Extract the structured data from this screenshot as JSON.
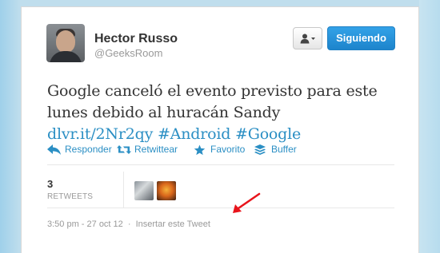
{
  "user": {
    "name": "Hector Russo",
    "handle": "@GeeksRoom"
  },
  "buttons": {
    "follow_label": "Siguiendo"
  },
  "tweet": {
    "text_line1": "Google canceló el evento previsto para este",
    "text_line2": "lunes debido al huracán Sandy",
    "link": "dlvr.it/2Nr2qy",
    "hashtag1": "#Android",
    "hashtag2": "#Google"
  },
  "actions": [
    {
      "label": "Responder",
      "icon": "reply-icon"
    },
    {
      "label": "Retwittear",
      "icon": "retweet-icon"
    },
    {
      "label": "Favorito",
      "icon": "star-icon"
    },
    {
      "label": "Buffer",
      "icon": "buffer-icon"
    }
  ],
  "stats": {
    "retweet_count": "3",
    "retweet_label": "RETWEETS"
  },
  "footer": {
    "timestamp": "3:50 pm - 27 oct 12",
    "separator": "·",
    "embed_label": "Insertar este Tweet"
  },
  "colors": {
    "page_background": "#c0deed",
    "link": "#2b8fc4",
    "follow_button": "#1d84cc",
    "annotation_arrow": "#e8141b"
  }
}
